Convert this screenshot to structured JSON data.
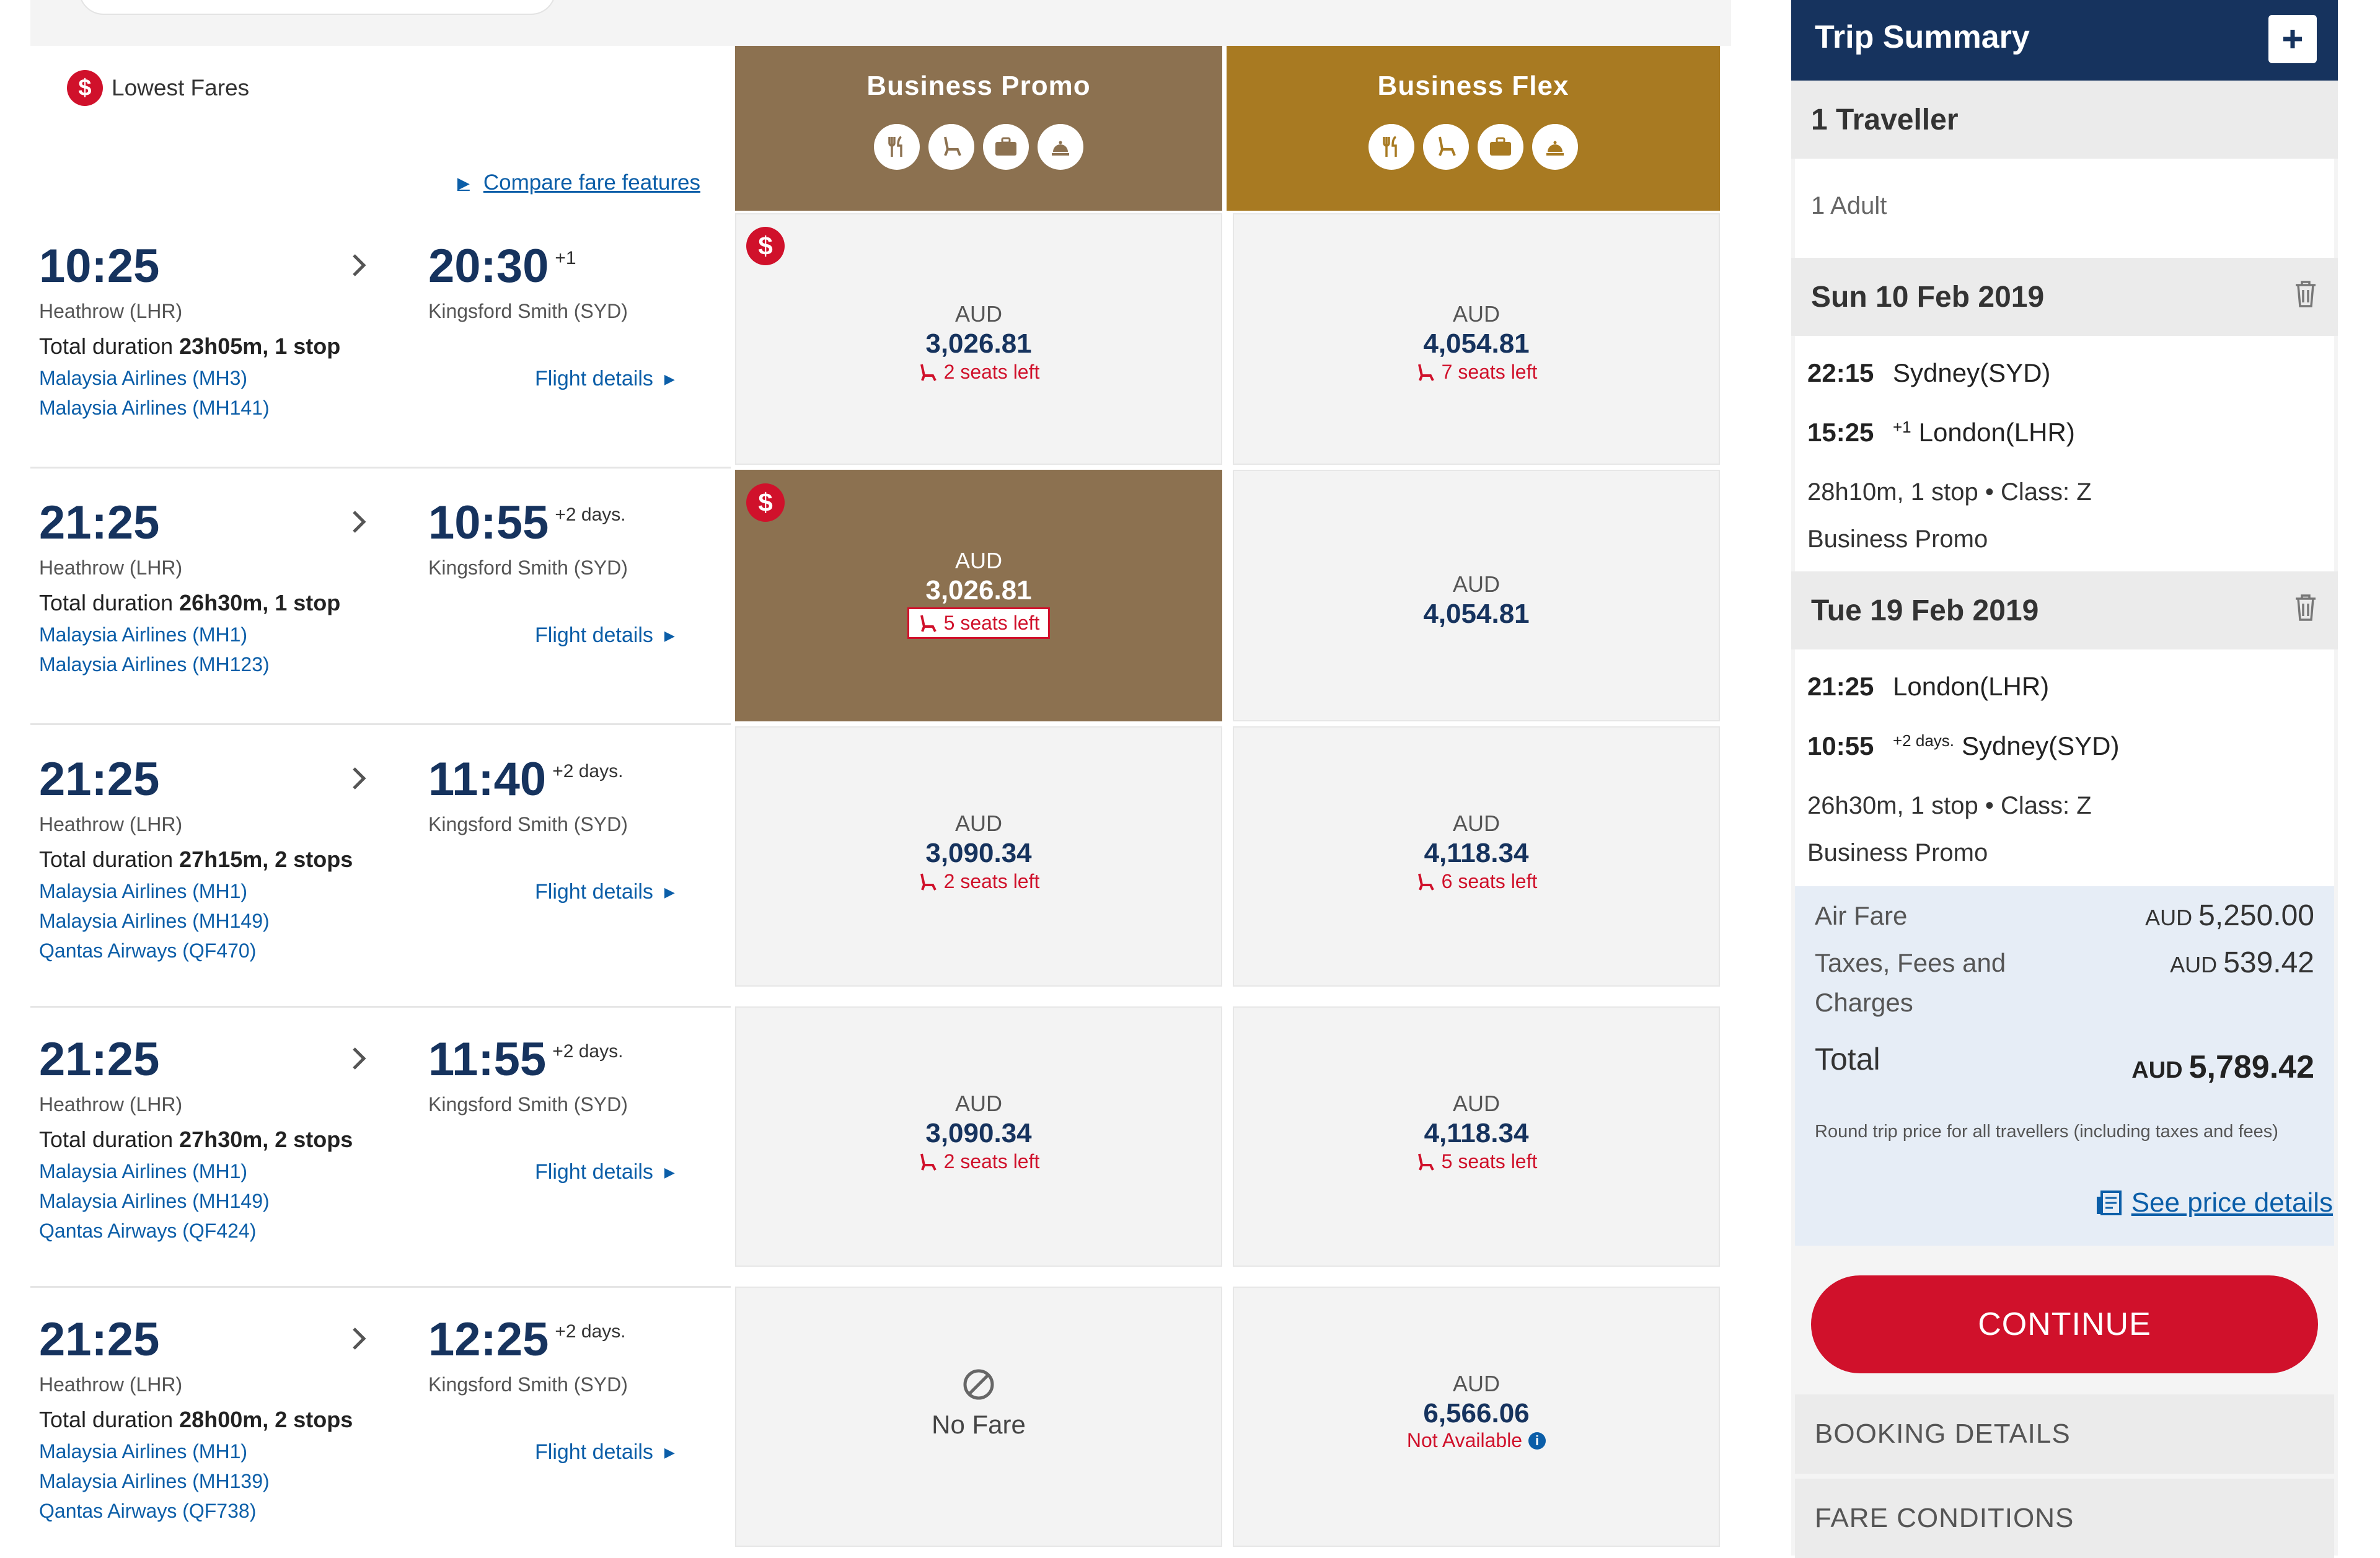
{
  "legend": {
    "badge": "$",
    "label": "Lowest Fares"
  },
  "compare_link": "Compare fare features",
  "fare_classes": [
    {
      "name": "Business Promo",
      "color": "#8c7150",
      "icons": [
        "meal-icon",
        "seat-icon",
        "baggage-icon",
        "lounge-icon"
      ]
    },
    {
      "name": "Business Flex",
      "color": "#a87a22",
      "icons": [
        "meal-icon",
        "seat-icon",
        "baggage-icon",
        "lounge-icon"
      ]
    }
  ],
  "flights": [
    {
      "dep_time": "10:25",
      "arr_time": "20:30",
      "arr_plus": "+1",
      "dep_airport": "Heathrow (LHR)",
      "arr_airport": "Kingsford Smith (SYD)",
      "duration_label": "Total duration ",
      "duration": "23h05m, 1 stop",
      "airlines": [
        "Malaysia Airlines (MH3)",
        "Malaysia Airlines (MH141)"
      ],
      "details": "Flight details",
      "promo": {
        "currency": "AUD",
        "amount": "3,026.81",
        "seats": "2 seats left",
        "lowest": true
      },
      "flex": {
        "currency": "AUD",
        "amount": "4,054.81",
        "seats": "7 seats left"
      }
    },
    {
      "dep_time": "21:25",
      "arr_time": "10:55",
      "arr_plus": "+2 days.",
      "dep_airport": "Heathrow (LHR)",
      "arr_airport": "Kingsford Smith (SYD)",
      "duration_label": "Total duration ",
      "duration": "26h30m, 1 stop",
      "airlines": [
        "Malaysia Airlines (MH1)",
        "Malaysia Airlines (MH123)"
      ],
      "details": "Flight details",
      "promo": {
        "currency": "AUD",
        "amount": "3,026.81",
        "seats": "5 seats left",
        "lowest": true,
        "selected": true
      },
      "flex": {
        "currency": "AUD",
        "amount": "4,054.81",
        "seats": ""
      }
    },
    {
      "dep_time": "21:25",
      "arr_time": "11:40",
      "arr_plus": "+2 days.",
      "dep_airport": "Heathrow (LHR)",
      "arr_airport": "Kingsford Smith (SYD)",
      "duration_label": "Total duration ",
      "duration": "27h15m, 2 stops",
      "airlines": [
        "Malaysia Airlines (MH1)",
        "Malaysia Airlines (MH149)",
        "Qantas Airways (QF470)"
      ],
      "details": "Flight details",
      "promo": {
        "currency": "AUD",
        "amount": "3,090.34",
        "seats": "2 seats left"
      },
      "flex": {
        "currency": "AUD",
        "amount": "4,118.34",
        "seats": "6 seats left"
      }
    },
    {
      "dep_time": "21:25",
      "arr_time": "11:55",
      "arr_plus": "+2 days.",
      "dep_airport": "Heathrow (LHR)",
      "arr_airport": "Kingsford Smith (SYD)",
      "duration_label": "Total duration ",
      "duration": "27h30m, 2 stops",
      "airlines": [
        "Malaysia Airlines (MH1)",
        "Malaysia Airlines (MH149)",
        "Qantas Airways (QF424)"
      ],
      "details": "Flight details",
      "promo": {
        "currency": "AUD",
        "amount": "3,090.34",
        "seats": "2 seats left"
      },
      "flex": {
        "currency": "AUD",
        "amount": "4,118.34",
        "seats": "5 seats left"
      }
    },
    {
      "dep_time": "21:25",
      "arr_time": "12:25",
      "arr_plus": "+2 days.",
      "dep_airport": "Heathrow (LHR)",
      "arr_airport": "Kingsford Smith (SYD)",
      "duration_label": "Total duration ",
      "duration": "28h00m, 2 stops",
      "airlines": [
        "Malaysia Airlines (MH1)",
        "Malaysia Airlines (MH139)",
        "Qantas Airways (QF738)"
      ],
      "details": "Flight details",
      "promo": {
        "no_fare": "No Fare"
      },
      "flex": {
        "currency": "AUD",
        "amount": "6,566.06",
        "not_available": "Not Available"
      }
    }
  ],
  "summary": {
    "title": "Trip Summary",
    "travellers_heading": "1 Traveller",
    "travellers": "1 Adult",
    "outbound": {
      "date": "Sun 10 Feb 2019",
      "dep_time": "22:15",
      "dep_place": "Sydney(SYD)",
      "arr_time": "15:25",
      "arr_plus": "+1",
      "arr_place": "London(LHR)",
      "info": "28h10m, 1 stop • Class: Z",
      "fare": "Business Promo"
    },
    "inbound": {
      "date": "Tue 19 Feb 2019",
      "dep_time": "21:25",
      "dep_place": "London(LHR)",
      "arr_time": "10:55",
      "arr_plus": "+2 days.",
      "arr_place": "Sydney(SYD)",
      "info": "26h30m, 1 stop • Class: Z",
      "fare": "Business Promo"
    },
    "air_fare_label": "Air Fare",
    "air_fare_cur": "AUD",
    "air_fare": "5,250.00",
    "taxes_label_1": "Taxes, Fees and",
    "taxes_label_2": "Charges",
    "taxes_cur": "AUD",
    "taxes": "539.42",
    "total_label": "Total",
    "total_cur": "AUD",
    "total": "5,789.42",
    "note": "Round trip price for all travellers (including taxes and fees)",
    "price_link": "See price details",
    "continue": "CONTINUE",
    "booking_details": "BOOKING DETAILS",
    "fare_conditions": "FARE CONDITIONS"
  }
}
